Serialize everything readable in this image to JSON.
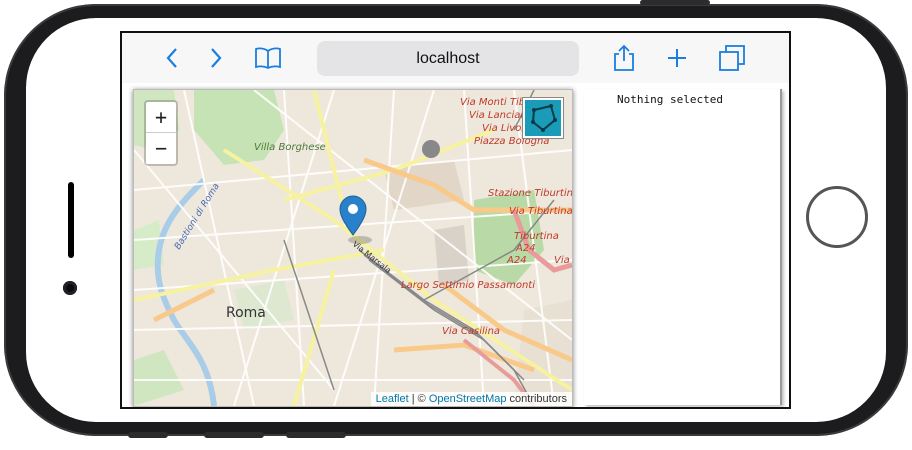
{
  "browser": {
    "url": "localhost",
    "icons": [
      "back-icon",
      "forward-icon",
      "bookmarks-icon",
      "share-icon",
      "add-tab-icon",
      "tabs-icon"
    ]
  },
  "map": {
    "zoom_in": "+",
    "zoom_out": "−",
    "labels": {
      "roma": "Roma",
      "villa_borghese": "Villa Borghese",
      "viale_muro_torto": "Viale del Muro Torto",
      "bastioni": "Bastioni di Roma",
      "via_monti_tiburtini": "Via Monti Tiburtini",
      "via_lanciani": "Via Lanciani",
      "via_livorno": "Via Livorno",
      "piazza_bologna": "Piazza Bologna",
      "stazione_tiburtina": "Stazione Tiburtina",
      "via_tiburtina": "Via Tiburtina",
      "tiburtina_a24": "Tiburtina",
      "a24_1": "A24",
      "a24_2": "A24",
      "via_right": "Via",
      "via_marsala": "Via Marsala",
      "largo_settimio": "Largo Settimio Passamonti",
      "via_casilina": "Via Casilina"
    },
    "attribution": {
      "leaflet": "Leaflet",
      "separator": " | © ",
      "osm": "OpenStreetMap",
      "suffix": " contributors"
    },
    "marker_color": "#2a81cb",
    "draw_button_color": "#1a9bb8"
  },
  "panel": {
    "text": "Nothing selected"
  }
}
